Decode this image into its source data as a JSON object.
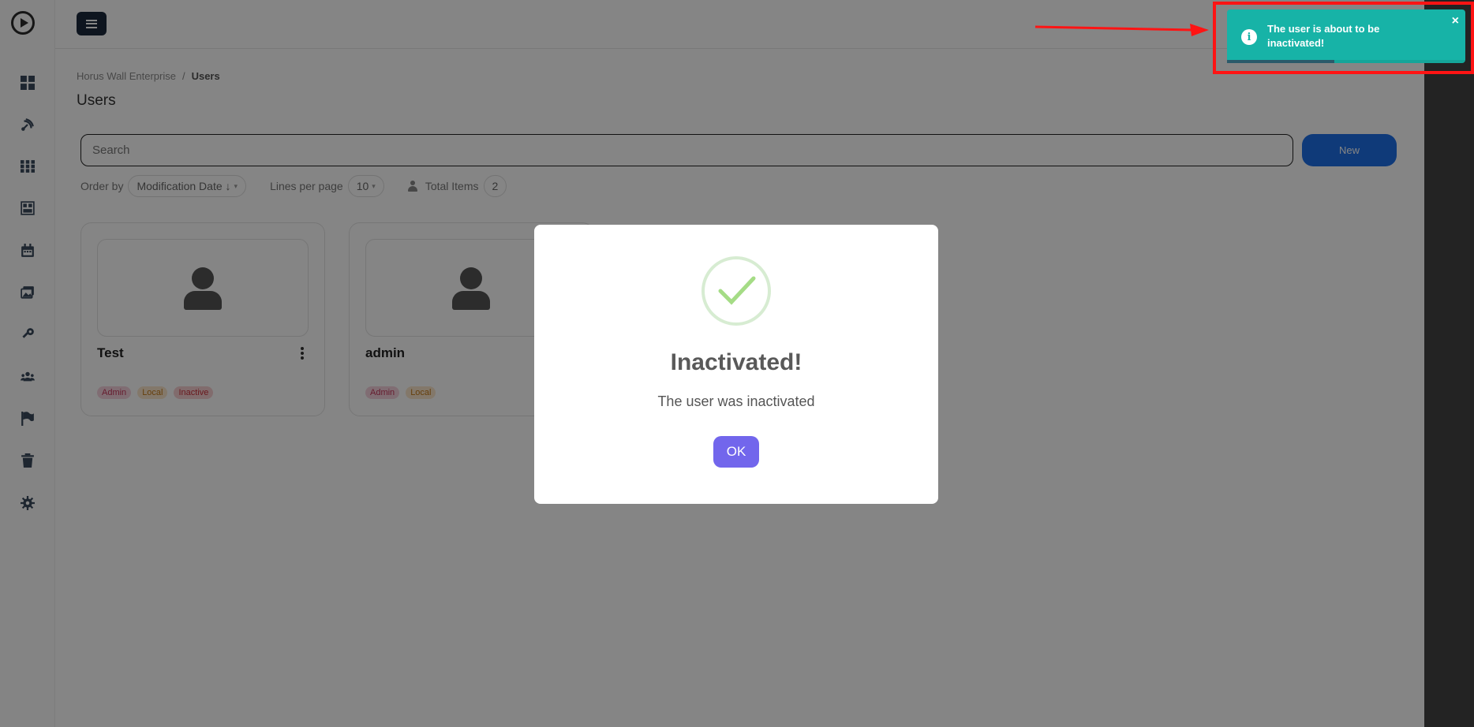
{
  "sidebar": {
    "items": [
      {
        "icon": "dashboard-icon"
      },
      {
        "icon": "satellite-icon"
      },
      {
        "icon": "grid-icon"
      },
      {
        "icon": "layout-icon"
      },
      {
        "icon": "calendar-icon"
      },
      {
        "icon": "images-icon"
      },
      {
        "icon": "key-icon"
      },
      {
        "icon": "users-icon"
      },
      {
        "icon": "flag-icon"
      },
      {
        "icon": "trash-icon"
      },
      {
        "icon": "gear-icon"
      }
    ]
  },
  "breadcrumb": {
    "root": "Horus Wall Enterprise",
    "separator": "/",
    "current": "Users"
  },
  "page": {
    "title": "Users"
  },
  "search": {
    "placeholder": "Search",
    "value": ""
  },
  "new_button": {
    "label": "New"
  },
  "filters": {
    "order_by_label": "Order by",
    "order_by_value": "Modification Date ↓",
    "lines_per_page_label": "Lines per page",
    "lines_per_page_value": "10",
    "total_items_label": "Total Items",
    "total_items_value": "2"
  },
  "users": [
    {
      "name": "Test",
      "tags": [
        "Admin",
        "Local",
        "Inactive"
      ]
    },
    {
      "name": "admin",
      "tags": [
        "Admin",
        "Local"
      ]
    }
  ],
  "modal": {
    "title": "Inactivated!",
    "text": "The user was inactivated",
    "ok_label": "OK"
  },
  "toast": {
    "message": "The user is about to be inactivated!",
    "close": "×",
    "info": "i",
    "progress": 0.45
  },
  "colors": {
    "accent": "#1d6fe8",
    "toast": "#17b3a7",
    "modal_button": "#7266ec",
    "highlight": "#ff1414"
  }
}
